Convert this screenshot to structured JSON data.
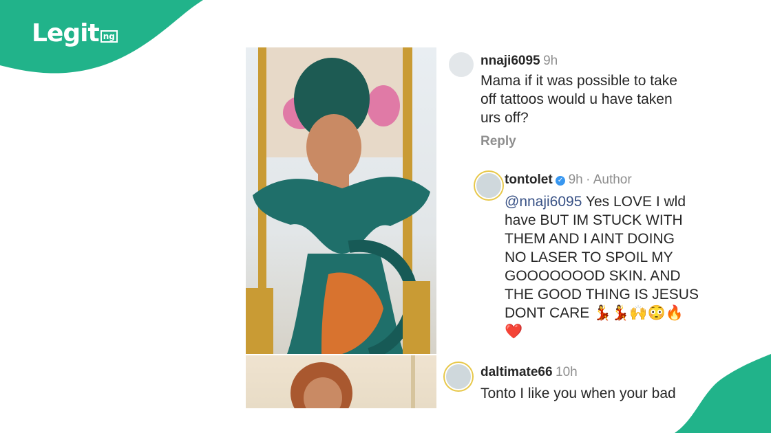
{
  "brand": {
    "logo_text": "Legit",
    "logo_suffix": "ng",
    "accent": "#21b38a"
  },
  "comments": [
    {
      "handle": "nnaji6095",
      "time": "9h",
      "text_lines": [
        "Mama if it was possible to take",
        "off tattoos would u have taken",
        "urs off?"
      ],
      "reply_label": "Reply"
    },
    {
      "handle": "tontolet",
      "time": "9h",
      "author_label": "· Author",
      "mention": "@nnaji6095",
      "text_lines": [
        " Yes LOVE I wld",
        "have BUT IM STUCK WITH",
        "THEM AND I AINT DOING",
        "NO LASER TO SPOIL MY",
        "GOOOOOOOD SKIN. AND",
        "THE GOOD THING IS JESUS",
        "DONT CARE 💃💃🙌😳🔥",
        "❤️"
      ]
    },
    {
      "handle": "daltimate66",
      "time": "10h",
      "text_lines": [
        "Tonto I like you when your bad"
      ]
    }
  ],
  "icons": {
    "verified": "verified-badge-icon"
  }
}
